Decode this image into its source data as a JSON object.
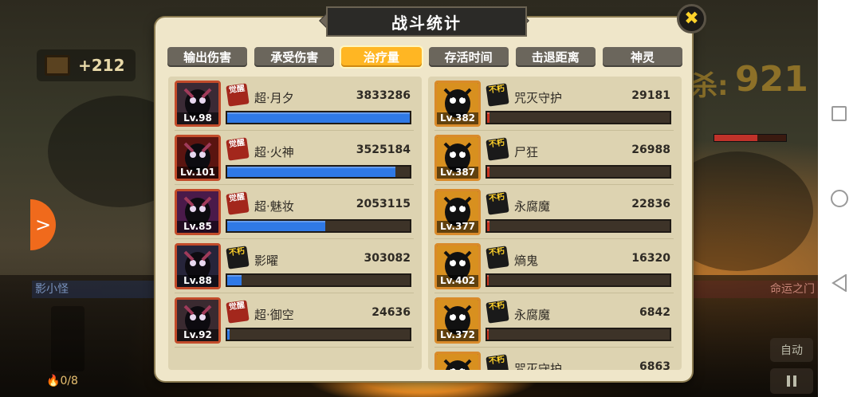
{
  "panel": {
    "title": "战斗统计",
    "close_label": "✖"
  },
  "tabs": [
    {
      "label": "输出伤害",
      "active": false
    },
    {
      "label": "承受伤害",
      "active": false
    },
    {
      "label": "治疗量",
      "active": true
    },
    {
      "label": "存活时间",
      "active": false
    },
    {
      "label": "击退距离",
      "active": false
    },
    {
      "label": "神灵",
      "active": false
    }
  ],
  "left_list": [
    {
      "name": "超·月夕",
      "level": "Lv.98",
      "badge": "觉醒",
      "value": "3833286",
      "fill": 1.0
    },
    {
      "name": "超·火神",
      "level": "Lv.101",
      "badge": "觉醒",
      "value": "3525184",
      "fill": 0.92
    },
    {
      "name": "超·魅妆",
      "level": "Lv.85",
      "badge": "觉醒",
      "value": "2053115",
      "fill": 0.535
    },
    {
      "name": "影曜",
      "level": "Lv.88",
      "badge": "不朽",
      "value": "303082",
      "fill": 0.079
    },
    {
      "name": "超·御空",
      "level": "Lv.92",
      "badge": "觉醒",
      "value": "24636",
      "fill": 0.012
    }
  ],
  "right_list": [
    {
      "name": "咒灭守护",
      "level": "Lv.382",
      "badge": "不朽",
      "value": "29181",
      "fill": 0.012
    },
    {
      "name": "尸狂",
      "level": "Lv.387",
      "badge": "不朽",
      "value": "26988",
      "fill": 0.012
    },
    {
      "name": "永腐魔",
      "level": "Lv.377",
      "badge": "不朽",
      "value": "22836",
      "fill": 0.012
    },
    {
      "name": "熵鬼",
      "level": "Lv.402",
      "badge": "不朽",
      "value": "16320",
      "fill": 0.01
    },
    {
      "name": "永腐魔",
      "level": "Lv.372",
      "badge": "不朽",
      "value": "6842",
      "fill": 0.005
    },
    {
      "name": "咒灭守护",
      "level": "",
      "badge": "不朽",
      "value": "6863",
      "fill": 0.005
    }
  ],
  "hud": {
    "chest_value": "+212",
    "score_label": "杀:",
    "score_value": "921",
    "team_left": "影小怪",
    "team_right": "命运之门",
    "auto_label": "自动",
    "energy": "0/8",
    "side_arrow": ">"
  },
  "colors": {
    "panel_bg": "#efe6c9",
    "tab_active": "#ffb623",
    "bar_ally": "#2f79e6",
    "bar_enemy": "#c8321f"
  }
}
